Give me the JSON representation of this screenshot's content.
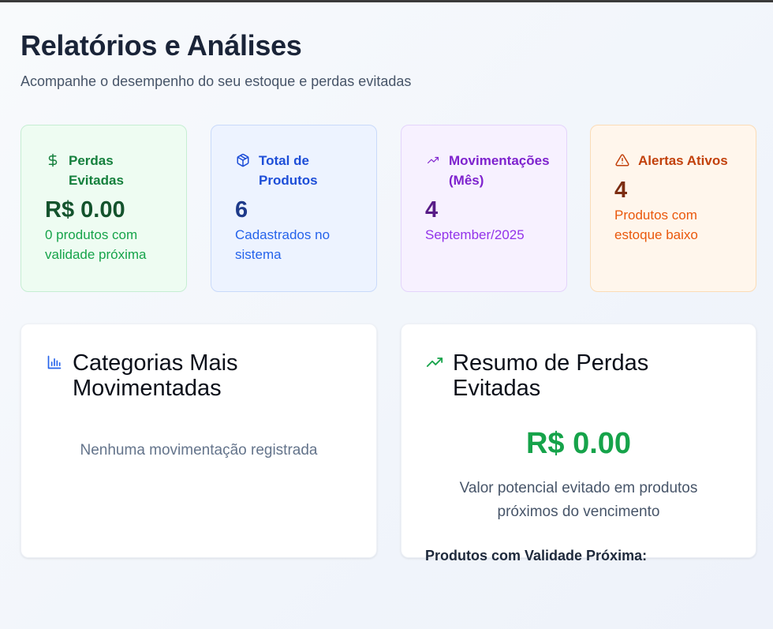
{
  "page": {
    "title": "Relatórios e Análises",
    "subtitle": "Acompanhe o desempenho do seu estoque e perdas evitadas"
  },
  "stats": [
    {
      "icon": "dollar-icon",
      "label": "Perdas Evitadas",
      "value": "R$ 0.00",
      "description": "0 produtos com validade próxima",
      "color": "#15803d"
    },
    {
      "icon": "package-icon",
      "label": "Total de Produtos",
      "value": "6",
      "description": "Cadastrados no sistema",
      "color": "#1d4ed8"
    },
    {
      "icon": "trending-up-icon",
      "label": "Movimentações (Mês)",
      "value": "4",
      "description": "September/2025",
      "color": "#7e22ce"
    },
    {
      "icon": "warning-icon",
      "label": "Alertas Ativos",
      "value": "4",
      "description": "Produtos com estoque baixo",
      "color": "#c2410c"
    }
  ],
  "categories_panel": {
    "icon": "bar-chart-icon",
    "title": "Categorias Mais Movimentadas",
    "empty_message": "Nenhuma movimentação registrada"
  },
  "summary_panel": {
    "icon": "trending-up-icon",
    "title": "Resumo de Perdas Evitadas",
    "value": "R$ 0.00",
    "description": "Valor potencial evitado em produtos próximos do vencimento",
    "subheading": "Produtos com Validade Próxima:"
  }
}
